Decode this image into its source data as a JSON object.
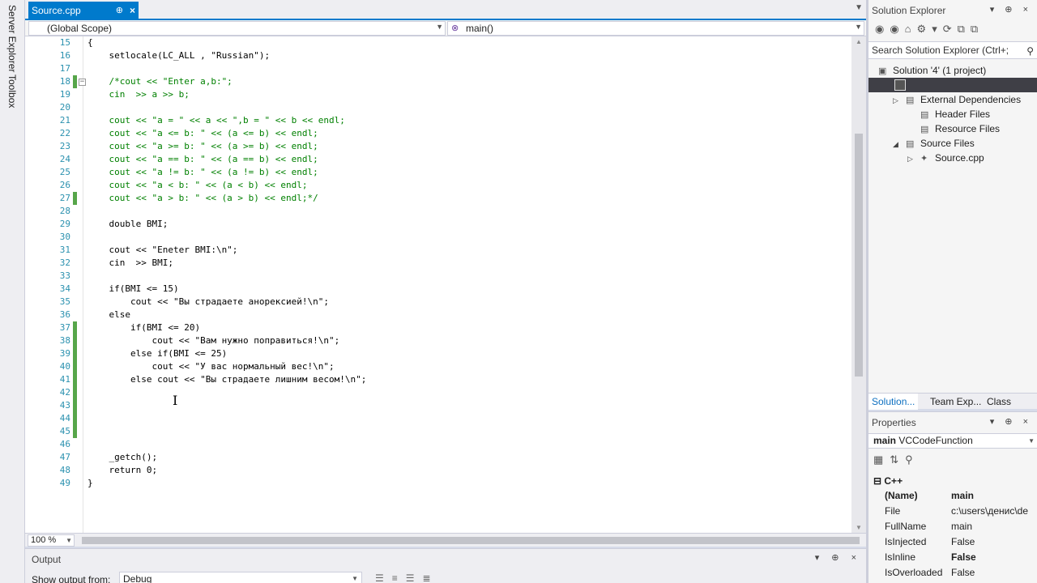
{
  "left_strip": {
    "tabs": [
      "Server Explorer",
      "Toolbox"
    ]
  },
  "document_tab": {
    "label": "Source.cpp",
    "pin": "⊕",
    "close": "×"
  },
  "nav": {
    "scope": "(Global Scope)",
    "member": "main()"
  },
  "code_lines": [
    {
      "n": "15",
      "t": "{",
      "color": "#000000"
    },
    {
      "n": "16",
      "t": "    setlocale(LC_ALL , \"Russian\");",
      "color": "#000000"
    },
    {
      "n": "17",
      "t": "",
      "color": "#000000"
    },
    {
      "n": "18",
      "t": "    /*cout << \"Enter a,b:\";",
      "color": "#008000"
    },
    {
      "n": "19",
      "t": "    cin  >> a >> b;",
      "color": "#008000"
    },
    {
      "n": "20",
      "t": "",
      "color": "#008000"
    },
    {
      "n": "21",
      "t": "    cout << \"a = \" << a << \",b = \" << b << endl;",
      "color": "#008000"
    },
    {
      "n": "22",
      "t": "    cout << \"a <= b: \" << (a <= b) << endl;",
      "color": "#008000"
    },
    {
      "n": "23",
      "t": "    cout << \"a >= b: \" << (a >= b) << endl;",
      "color": "#008000"
    },
    {
      "n": "24",
      "t": "    cout << \"a == b: \" << (a == b) << endl;",
      "color": "#008000"
    },
    {
      "n": "25",
      "t": "    cout << \"a != b: \" << (a != b) << endl;",
      "color": "#008000"
    },
    {
      "n": "26",
      "t": "    cout << \"a < b: \" << (a < b) << endl;",
      "color": "#008000"
    },
    {
      "n": "27",
      "t": "    cout << \"a > b: \" << (a > b) << endl;*/",
      "color": "#008000"
    },
    {
      "n": "28",
      "t": "",
      "color": "#000000"
    },
    {
      "n": "29",
      "t": "    double BMI;",
      "color": "#000000"
    },
    {
      "n": "30",
      "t": "",
      "color": "#000000"
    },
    {
      "n": "31",
      "t": "    cout << \"Eneter BMI:\\n\";",
      "color": "#000000"
    },
    {
      "n": "32",
      "t": "    cin  >> BMI;",
      "color": "#000000"
    },
    {
      "n": "33",
      "t": "",
      "color": "#000000"
    },
    {
      "n": "34",
      "t": "    if(BMI <= 15)",
      "color": "#000000"
    },
    {
      "n": "35",
      "t": "        cout << \"Вы страдаете анорексией!\\n\";",
      "color": "#000000"
    },
    {
      "n": "36",
      "t": "    else",
      "color": "#000000"
    },
    {
      "n": "37",
      "t": "        if(BMI <= 20)",
      "color": "#000000"
    },
    {
      "n": "38",
      "t": "            cout << \"Вам нужно поправиться!\\n\";",
      "color": "#000000"
    },
    {
      "n": "39",
      "t": "        else if(BMI <= 25)",
      "color": "#000000"
    },
    {
      "n": "40",
      "t": "            cout << \"У вас нормальный вес!\\n\";",
      "color": "#000000"
    },
    {
      "n": "41",
      "t": "        else cout << \"Вы страдаете лишним весом!\\n\";",
      "color": "#000000"
    },
    {
      "n": "42",
      "t": "",
      "color": "#000000"
    },
    {
      "n": "43",
      "t": "",
      "color": "#000000"
    },
    {
      "n": "44",
      "t": "",
      "color": "#000000"
    },
    {
      "n": "45",
      "t": "",
      "color": "#000000"
    },
    {
      "n": "46",
      "t": "",
      "color": "#000000"
    },
    {
      "n": "47",
      "t": "    _getch();",
      "color": "#000000"
    },
    {
      "n": "48",
      "t": "    return 0;",
      "color": "#000000"
    },
    {
      "n": "49",
      "t": "}",
      "color": "#000000"
    }
  ],
  "change_marks": [
    "18",
    "27",
    "37",
    "38",
    "39",
    "40",
    "41",
    "42",
    "43",
    "44",
    "45"
  ],
  "editor": {
    "zoom": "100 %"
  },
  "output": {
    "title": "Output",
    "show_from_label": "Show output from:",
    "show_from_value": "Debug"
  },
  "solution_explorer": {
    "title": "Solution Explorer",
    "search_placeholder": "Search Solution Explorer (Ctrl+;",
    "solution": "Solution '4' (1 project)",
    "items": [
      {
        "label": "External Dependencies",
        "twisty": "▷"
      },
      {
        "label": "Header Files",
        "twisty": ""
      },
      {
        "label": "Resource Files",
        "twisty": ""
      },
      {
        "label": "Source Files",
        "twisty": "◢"
      },
      {
        "label": "Source.cpp",
        "twisty": "▷"
      }
    ],
    "tabs": [
      "Solution...",
      "Team Exp...",
      "Class View"
    ]
  },
  "properties": {
    "title": "Properties",
    "object_name": "main",
    "object_type": "VCCodeFunction",
    "category": "C++",
    "rows": [
      {
        "name": "(Name)",
        "value": "main",
        "bold": true
      },
      {
        "name": "File",
        "value": "c:\\users\\денис\\de",
        "bold": false
      },
      {
        "name": "FullName",
        "value": "main",
        "bold": false
      },
      {
        "name": "IsInjected",
        "value": "False",
        "bold": false
      },
      {
        "name": "IsInline",
        "value": "False",
        "bold": true
      },
      {
        "name": "IsOverloaded",
        "value": "False",
        "bold": false
      }
    ]
  },
  "colors": {
    "accent": "#007acc",
    "line_number": "#2b91af",
    "comment": "#008000",
    "change_mark": "#57a64a"
  }
}
